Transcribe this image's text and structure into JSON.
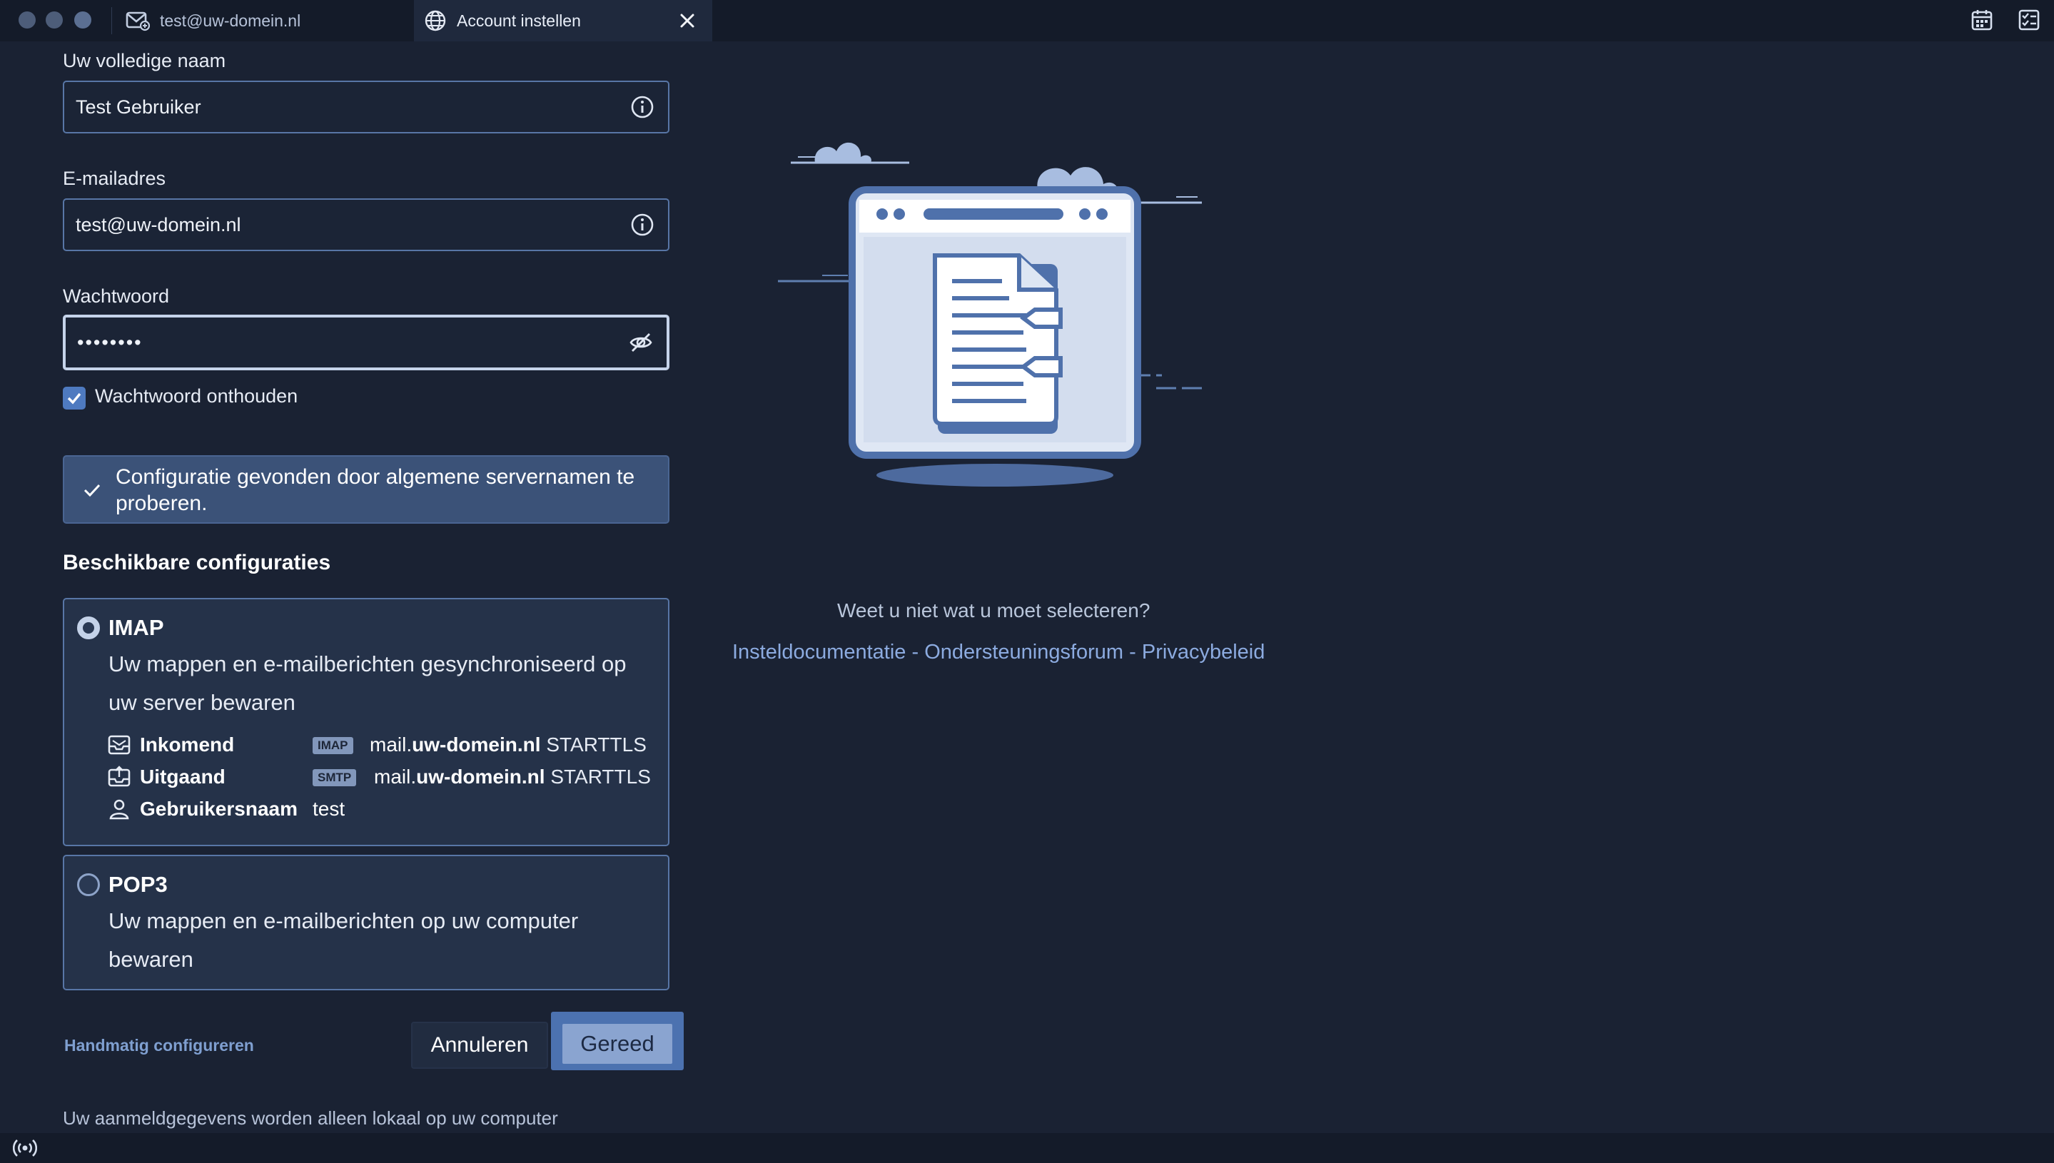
{
  "window": {
    "tabs": [
      {
        "label": "test@uw-domein.nl",
        "icon": "mail-icon"
      },
      {
        "label": "Account instellen",
        "icon": "globe-icon"
      }
    ]
  },
  "form": {
    "name": {
      "label": "Uw volledige naam",
      "value": "Test Gebruiker"
    },
    "email": {
      "label": "E-mailadres",
      "value": "test@uw-domein.nl"
    },
    "password": {
      "label": "Wachtwoord",
      "value": "••••••••"
    },
    "remember": {
      "label": "Wachtwoord onthouden",
      "checked": true
    },
    "banner": "Configuratie gevonden door algemene servernamen te proberen.",
    "configs_title": "Beschikbare configuraties",
    "options": {
      "imap": {
        "title": "IMAP",
        "desc": "Uw mappen en e-mailberichten gesynchroniseerd op uw server bewaren",
        "incoming_label": "Inkomend",
        "incoming_badge": "IMAP",
        "incoming_host_prefix": "mail.",
        "incoming_host_domain": "uw-domein.nl",
        "incoming_security": "STARTTLS",
        "outgoing_label": "Uitgaand",
        "outgoing_badge": "SMTP",
        "outgoing_host_prefix": "mail.",
        "outgoing_host_domain": "uw-domein.nl",
        "outgoing_security": "STARTTLS",
        "user_label": "Gebruikersnaam",
        "user_value": "test"
      },
      "pop3": {
        "title": "POP3",
        "desc": "Uw mappen en e-mailberichten op uw computer bewaren"
      }
    },
    "manual": "Handmatig configureren",
    "cancel": "Annuleren",
    "done": "Gereed",
    "footer": "Uw aanmeldgegevens worden alleen lokaal op uw computer"
  },
  "help": {
    "question": "Weet u niet wat u moet selecteren?",
    "links": [
      "Insteldocumentatie",
      "Ondersteuningsforum",
      "Privacybeleid"
    ],
    "separator": " - "
  },
  "colors": {
    "background": "#1a2233",
    "accent": "#4c72b0",
    "border": "#5876a6",
    "link": "#8cabe0"
  }
}
